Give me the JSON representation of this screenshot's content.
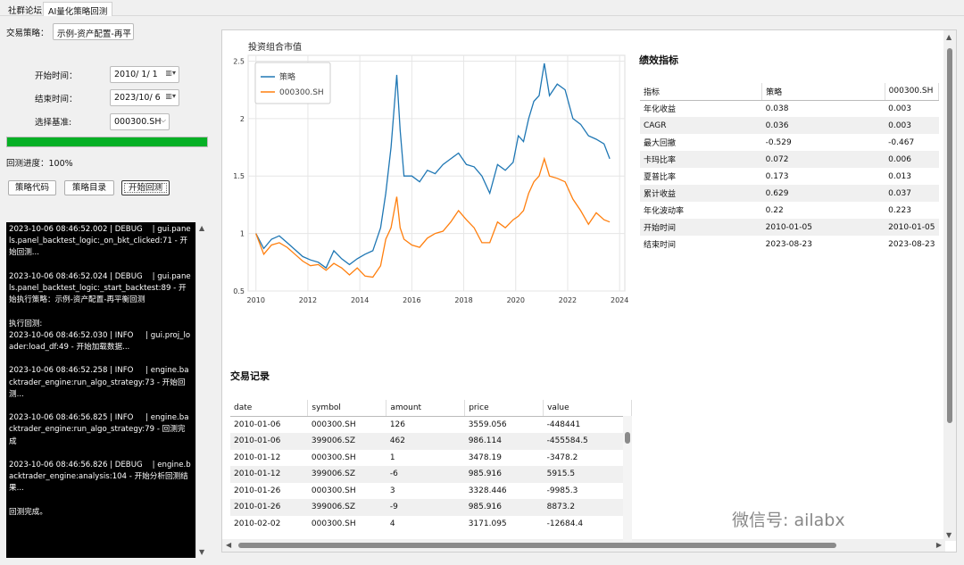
{
  "tabs": [
    "社群论坛",
    "AI量化策略回测"
  ],
  "controls": {
    "strategy_label": "交易策略：",
    "strategy_value": "示例-资产配置-再平",
    "start_label": "开始时间：",
    "start_value": "2010/ 1/ 1",
    "end_label": "结束时间：",
    "end_value": "2023/10/ 6",
    "bench_label": "选择基准:",
    "bench_value": "000300.SH",
    "progress_fraction": 1.0,
    "progress_text": "回测进度：100%",
    "buttons": [
      "策略代码",
      "策略目录",
      "开始回测"
    ]
  },
  "console_text": "2023-10-06 08:46:52.002 | DEBUG    | gui.panels.panel_backtest_logic:_on_bkt_clicked:71 - 开始回测...\n\n2023-10-06 08:46:52.024 | DEBUG    | gui.panels.panel_backtest_logic:_start_backtest:89 - 开始执行策略：示例-资产配置-再平衡回测\n\n执行回测:\n2023-10-06 08:46:52.030 | INFO     | gui.proj_loader:load_df:49 - 开始加载数据...\n\n2023-10-06 08:46:52.258 | INFO     | engine.backtrader_engine:run_algo_strategy:73 - 开始回测...\n\n2023-10-06 08:46:56.825 | INFO     | engine.backtrader_engine:run_algo_strategy:79 - 回测完成\n\n2023-10-06 08:46:56.826 | DEBUG    | engine.backtrader_engine:analysis:104 - 开始分析回测结果...\n\n回测完成。",
  "chart_data": {
    "type": "line",
    "title": "投资组合市值",
    "xlim": [
      2009.7,
      2024.2
    ],
    "ylim": [
      0.5,
      2.55
    ],
    "xticks": [
      2010,
      2012,
      2014,
      2016,
      2018,
      2020,
      2022,
      2024
    ],
    "yticks": [
      0.5,
      1,
      1.5,
      2,
      2.5
    ],
    "grid": true,
    "legend": "top-left",
    "series": [
      {
        "name": "策略",
        "color": "#1f77b4",
        "x": [
          2010.0,
          2010.3,
          2010.6,
          2010.9,
          2011.2,
          2011.5,
          2011.8,
          2012.1,
          2012.4,
          2012.7,
          2013.0,
          2013.3,
          2013.6,
          2013.9,
          2014.2,
          2014.5,
          2014.8,
          2015.0,
          2015.2,
          2015.42,
          2015.55,
          2015.7,
          2016.0,
          2016.3,
          2016.6,
          2016.9,
          2017.2,
          2017.5,
          2017.8,
          2018.1,
          2018.4,
          2018.7,
          2019.0,
          2019.3,
          2019.6,
          2019.9,
          2020.1,
          2020.3,
          2020.5,
          2020.7,
          2020.9,
          2021.1,
          2021.3,
          2021.6,
          2021.9,
          2022.2,
          2022.5,
          2022.8,
          2023.1,
          2023.4,
          2023.62
        ],
        "y": [
          1.0,
          0.87,
          0.95,
          0.98,
          0.92,
          0.86,
          0.8,
          0.77,
          0.75,
          0.7,
          0.85,
          0.78,
          0.73,
          0.78,
          0.82,
          0.85,
          1.05,
          1.35,
          1.75,
          2.38,
          1.9,
          1.5,
          1.5,
          1.45,
          1.55,
          1.52,
          1.6,
          1.65,
          1.7,
          1.6,
          1.58,
          1.5,
          1.35,
          1.6,
          1.55,
          1.62,
          1.85,
          1.8,
          2.0,
          2.15,
          2.2,
          2.48,
          2.2,
          2.3,
          2.25,
          2.0,
          1.95,
          1.85,
          1.82,
          1.78,
          1.65
        ]
      },
      {
        "name": "000300.SH",
        "color": "#ff7f0e",
        "x": [
          2010.0,
          2010.3,
          2010.6,
          2010.9,
          2011.2,
          2011.5,
          2011.8,
          2012.1,
          2012.4,
          2012.7,
          2013.0,
          2013.3,
          2013.6,
          2013.9,
          2014.2,
          2014.5,
          2014.8,
          2015.0,
          2015.2,
          2015.42,
          2015.55,
          2015.7,
          2016.0,
          2016.3,
          2016.6,
          2016.9,
          2017.2,
          2017.5,
          2017.8,
          2018.1,
          2018.4,
          2018.7,
          2019.0,
          2019.3,
          2019.6,
          2019.9,
          2020.1,
          2020.3,
          2020.5,
          2020.7,
          2020.9,
          2021.1,
          2021.3,
          2021.6,
          2021.9,
          2022.2,
          2022.5,
          2022.8,
          2023.1,
          2023.4,
          2023.62
        ],
        "y": [
          1.0,
          0.82,
          0.9,
          0.92,
          0.88,
          0.82,
          0.76,
          0.72,
          0.73,
          0.68,
          0.74,
          0.7,
          0.64,
          0.7,
          0.63,
          0.62,
          0.72,
          0.95,
          1.05,
          1.32,
          1.05,
          0.95,
          0.9,
          0.88,
          0.96,
          1.0,
          1.02,
          1.1,
          1.2,
          1.12,
          1.05,
          0.92,
          0.92,
          1.1,
          1.05,
          1.12,
          1.15,
          1.2,
          1.35,
          1.45,
          1.5,
          1.65,
          1.5,
          1.48,
          1.45,
          1.3,
          1.2,
          1.08,
          1.18,
          1.12,
          1.1
        ]
      }
    ]
  },
  "perf": {
    "title": "绩效指标",
    "headers": [
      "指标",
      "策略",
      "000300.SH"
    ],
    "rows": [
      [
        "年化收益",
        "0.038",
        "0.003"
      ],
      [
        "CAGR",
        "0.036",
        "0.003"
      ],
      [
        "最大回撤",
        "-0.529",
        "-0.467"
      ],
      [
        "卡玛比率",
        "0.072",
        "0.006"
      ],
      [
        "夏普比率",
        "0.173",
        "0.013"
      ],
      [
        "累计收益",
        "0.629",
        "0.037"
      ],
      [
        "年化波动率",
        "0.22",
        "0.223"
      ],
      [
        "开始时间",
        "2010-01-05",
        "2010-01-05"
      ],
      [
        "结束时间",
        "2023-08-23",
        "2023-08-23"
      ]
    ]
  },
  "trades": {
    "title": "交易记录",
    "headers": [
      "date",
      "symbol",
      "amount",
      "price",
      "value"
    ],
    "rows": [
      [
        "2010-01-06",
        "000300.SH",
        "126",
        "3559.056",
        "-448441"
      ],
      [
        "2010-01-06",
        "399006.SZ",
        "462",
        "986.114",
        "-455584.5"
      ],
      [
        "2010-01-12",
        "000300.SH",
        "1",
        "3478.19",
        "-3478.2"
      ],
      [
        "2010-01-12",
        "399006.SZ",
        "-6",
        "985.916",
        "5915.5"
      ],
      [
        "2010-01-26",
        "000300.SH",
        "3",
        "3328.446",
        "-9985.3"
      ],
      [
        "2010-01-26",
        "399006.SZ",
        "-9",
        "985.916",
        "8873.2"
      ],
      [
        "2010-02-02",
        "000300.SH",
        "4",
        "3171.095",
        "-12684.4"
      ]
    ]
  },
  "watermark": "微信号: ailabx",
  "colors": {
    "progress": "#06b025",
    "console_bg": "#000000"
  }
}
